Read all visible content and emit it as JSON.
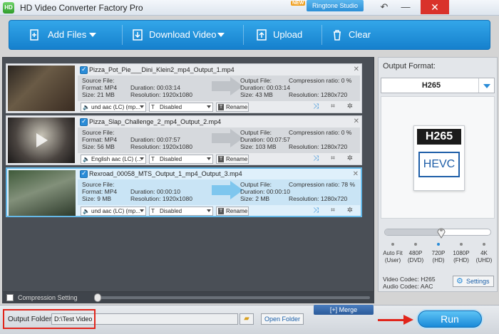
{
  "window": {
    "title": "HD Video Converter Factory Pro",
    "logo_text": "HD",
    "new_badge": "NEW",
    "ringtone_label": "Ringtone Studio",
    "close_glyph": "✕",
    "undo_glyph": "↶",
    "minimize_glyph": "—"
  },
  "toolbar": {
    "add_files": "Add Files",
    "download_video": "Download Video",
    "upload": "Upload",
    "clear": "Clear"
  },
  "tasks": [
    {
      "file_name": "Pizza_Pot_Pie___Dini_Klein2_mp4_Output_1.mp4",
      "source_label": "Source File:",
      "source_format": "Format: MP4",
      "source_duration": "Duration: 00:03:14",
      "source_size": "Size: 21 MB",
      "source_resolution": "Resolution: 1920x1080",
      "output_label": "Output File:",
      "output_duration": "Duration: 00:03:14",
      "output_size": "Size: 43 MB",
      "output_resolution": "Resolution: 1280x720",
      "compression": "Compression ratio: 0 %",
      "audio": "und aac (LC) (mp...",
      "subtitle": "Disabled",
      "rename": "Rename"
    },
    {
      "file_name": "Pizza_Slap_Challenge_2_mp4_Output_2.mp4",
      "source_label": "Source File:",
      "source_format": "Format: MP4",
      "source_duration": "Duration: 00:07:57",
      "source_size": "Size: 56 MB",
      "source_resolution": "Resolution: 1920x1080",
      "output_label": "Output File:",
      "output_duration": "Duration: 00:07:57",
      "output_size": "Size: 103 MB",
      "output_resolution": "Resolution: 1280x720",
      "compression": "Compression ratio: 0 %",
      "audio": "English aac (LC) (...",
      "subtitle": "Disabled",
      "rename": "Rename"
    },
    {
      "file_name": "Rexroad_00058_MTS_Output_1_mp4_Output_3.mp4",
      "source_label": "Source File:",
      "source_format": "Format: MP4",
      "source_duration": "Duration: 00:00:10",
      "source_size": "Size: 9 MB",
      "source_resolution": "Resolution: 1920x1080",
      "output_label": "Output File:",
      "output_duration": "Duration: 00:00:10",
      "output_size": "Size: 2 MB",
      "output_resolution": "Resolution: 1280x720",
      "compression": "Compression ratio: 78 %",
      "audio": "und aac (LC) (mp...",
      "subtitle": "Disabled",
      "rename": "Rename"
    }
  ],
  "right_panel": {
    "output_format_label": "Output Format:",
    "format_value": "H265",
    "format_icon_top": "H265",
    "format_icon_bottom": "HEVC",
    "quality_level": 0.53,
    "quality_options": [
      {
        "line1": "Auto Fit",
        "line2": "(User)"
      },
      {
        "line1": "480P",
        "line2": "(DVD)"
      },
      {
        "line1": "720P",
        "line2": "(HD)"
      },
      {
        "line1": "1080P",
        "line2": "(FHD)"
      },
      {
        "line1": "4K",
        "line2": "(UHD)"
      }
    ],
    "selected_quality": "720P",
    "video_codec": "Video Codec: H265",
    "audio_codec": "Audio Codec: AAC",
    "settings_label": "Settings"
  },
  "compression": {
    "label": "Compression Setting"
  },
  "bottom": {
    "merge_label": "Merge",
    "output_folder_label": "Output Folder:",
    "output_folder_value": "D:\\Test Video",
    "open_folder": "Open Folder",
    "run_label": "Run"
  },
  "colors": {
    "accent": "#1e88d6",
    "highlight_red": "#e1251b"
  }
}
